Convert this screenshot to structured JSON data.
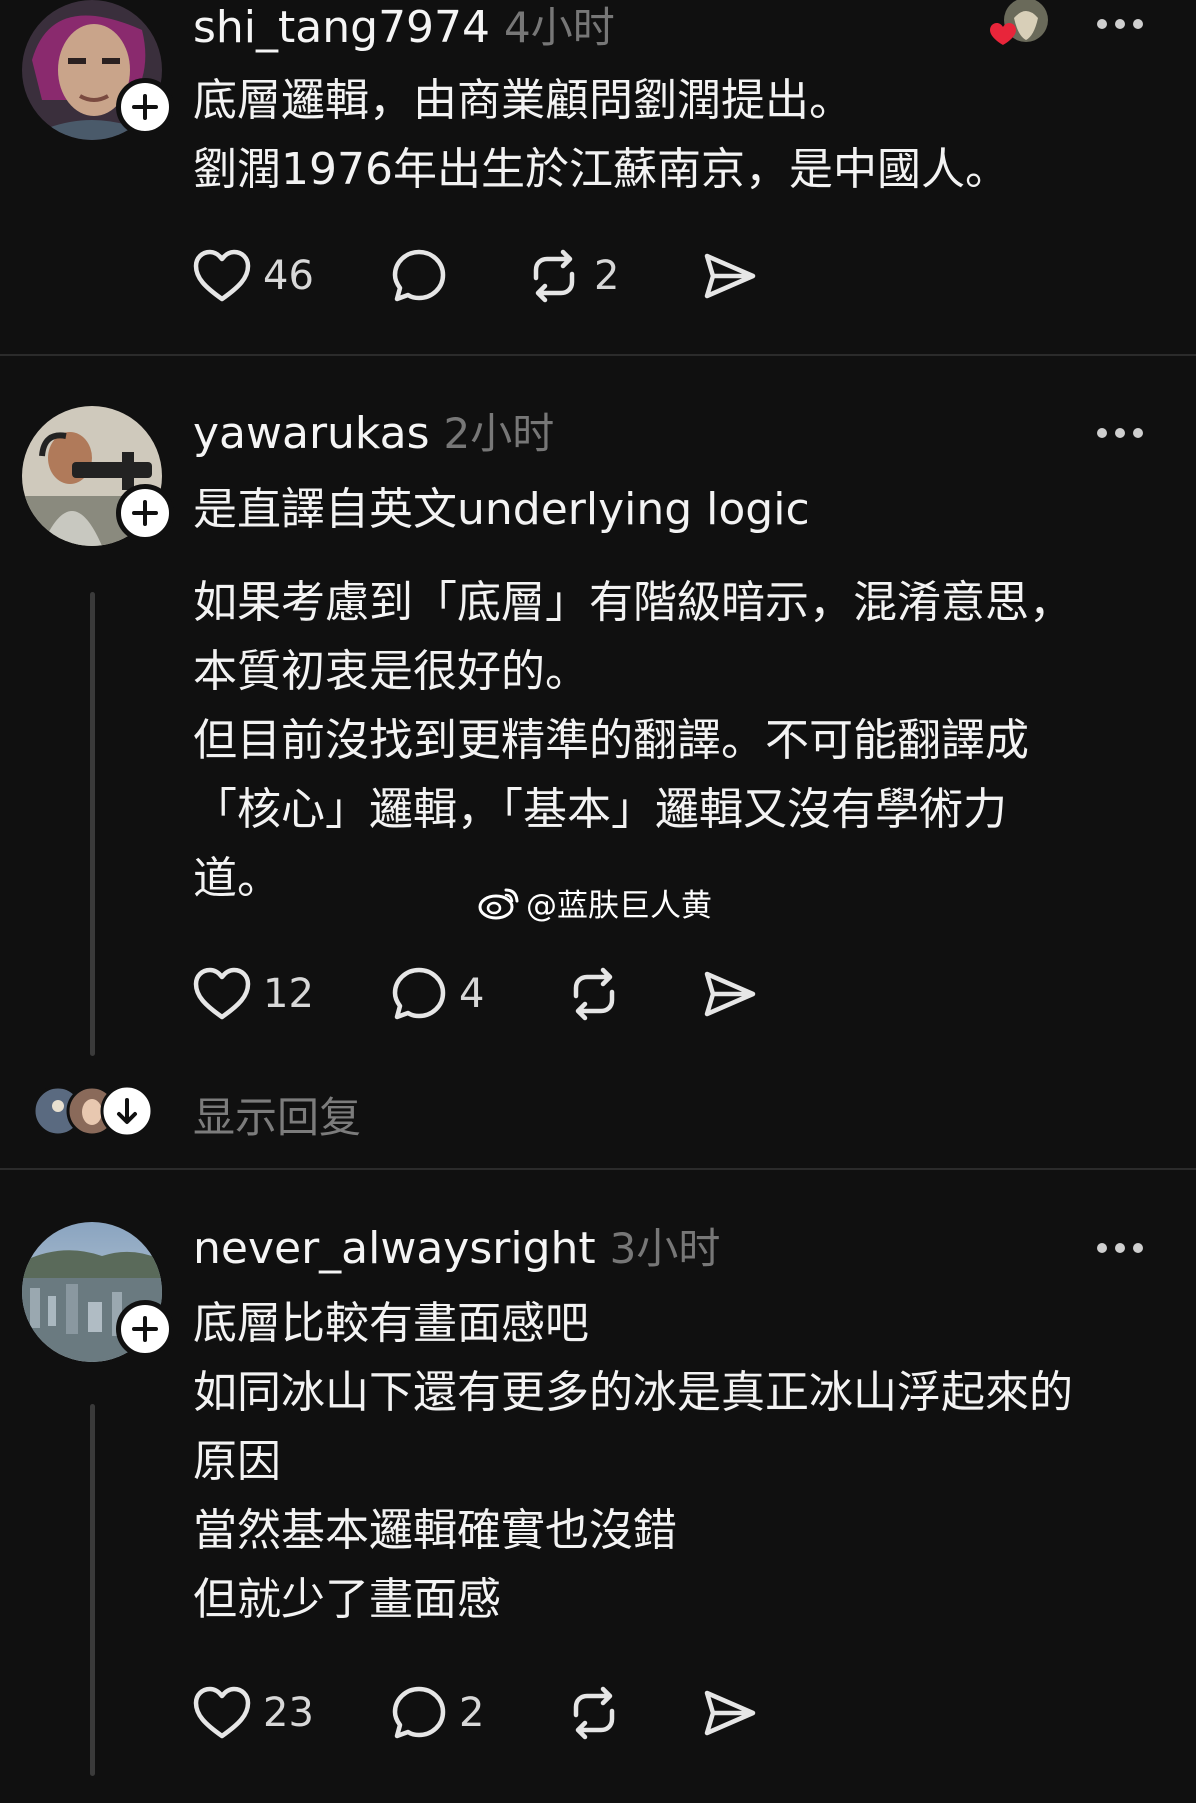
{
  "posts": [
    {
      "username": "shi_tang7974",
      "time": "4小时",
      "lines": [
        "底層邏輯，由商業顧問劉潤提出。",
        "劉潤1976年出生於江蘇南京，是中國人。"
      ],
      "likes": "46",
      "comments": "",
      "reposts": "2"
    },
    {
      "username": "yawarukas",
      "time": "2小时",
      "lines": [
        "是直譯自英文underlying logic"
      ],
      "lines2": [
        "如果考慮到「底層」有階級暗示，混淆意思，",
        "本質初衷是很好的。",
        "但目前沒找到更精準的翻譯。不可能翻譯成",
        "「核心」邏輯，「基本」邏輯又沒有學術力",
        "道。"
      ],
      "likes": "12",
      "comments": "4",
      "reposts": ""
    },
    {
      "username": "never_alwaysright",
      "time": "3小时",
      "lines": [
        "底層比較有畫面感吧",
        "如同冰山下還有更多的冰是真正冰山浮起來的",
        "原因",
        "當然基本邏輯確實也沒錯",
        "但就少了畫面感"
      ],
      "likes": "23",
      "comments": "2",
      "reposts": ""
    }
  ],
  "show_replies_label": "显示回复",
  "watermark_text": "@蓝肤巨人黄",
  "colors": {
    "background": "#101010",
    "text": "#f3f3f3",
    "muted": "#777777",
    "heart_red": "#e8253a"
  },
  "icons": [
    "plus-icon",
    "more-icon",
    "heart-icon",
    "comment-icon",
    "repost-icon",
    "share-icon",
    "weibo-icon",
    "arrow-down-icon"
  ]
}
